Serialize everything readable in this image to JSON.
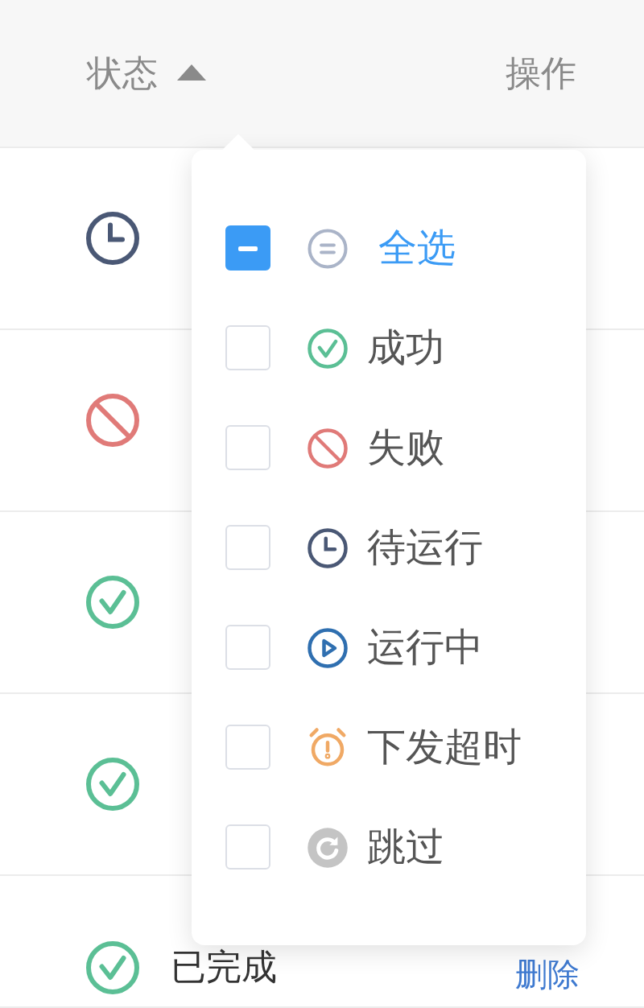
{
  "table": {
    "columns": [
      {
        "label": "状态",
        "sorted": true
      },
      {
        "label": "操作",
        "sorted": false
      }
    ],
    "rows": [
      {
        "kind": "pending"
      },
      {
        "kind": "failed"
      },
      {
        "kind": "success"
      },
      {
        "kind": "success"
      },
      {
        "kind": "success",
        "text": "已完成",
        "action": "删除"
      }
    ]
  },
  "filter_popup": {
    "items": [
      {
        "kind": "all",
        "label": "全选",
        "indeterminate": true
      },
      {
        "kind": "success",
        "label": "成功",
        "checked": false,
        "indeterminate": false
      },
      {
        "kind": "failed",
        "label": "失败",
        "checked": false,
        "indeterminate": false
      },
      {
        "kind": "pending",
        "label": "待运行",
        "checked": false,
        "indeterminate": false
      },
      {
        "kind": "running",
        "label": "运行中",
        "checked": false,
        "indeterminate": false
      },
      {
        "kind": "timeout",
        "label": "下发超时",
        "checked": false,
        "indeterminate": false
      },
      {
        "kind": "skipped",
        "label": "跳过",
        "checked": false,
        "indeterminate": false
      }
    ]
  }
}
